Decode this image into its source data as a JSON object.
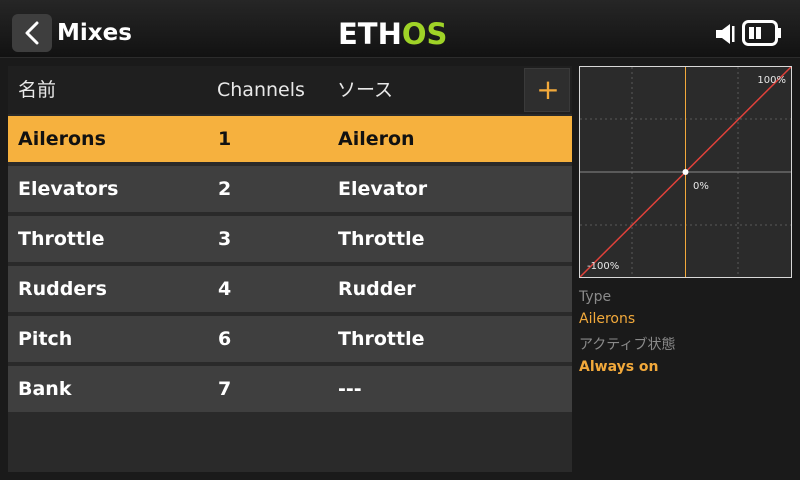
{
  "header": {
    "title": "Mixes",
    "logo_left": "ETH",
    "logo_right": "OS"
  },
  "colors": {
    "accent": "#f6b13e",
    "logo_green": "#9fd327",
    "curve": "#e0413a"
  },
  "icons": [
    "back-chevron-icon",
    "speaker-icon",
    "battery-icon",
    "plus-icon"
  ],
  "table": {
    "headers": {
      "name": "名前",
      "channels": "Channels",
      "source": "ソース"
    },
    "add_label": "+",
    "rows": [
      {
        "name": "Ailerons",
        "channel": "1",
        "source": "Aileron",
        "selected": true
      },
      {
        "name": "Elevators",
        "channel": "2",
        "source": "Elevator",
        "selected": false
      },
      {
        "name": "Throttle",
        "channel": "3",
        "source": "Throttle",
        "selected": false
      },
      {
        "name": "Rudders",
        "channel": "4",
        "source": "Rudder",
        "selected": false
      },
      {
        "name": "Pitch",
        "channel": "6",
        "source": "Throttle",
        "selected": false
      },
      {
        "name": "Bank",
        "channel": "7",
        "source": "---",
        "selected": false
      }
    ]
  },
  "graph": {
    "label_max": "100%",
    "label_center": "0%",
    "label_min": "-100%",
    "curve_points": [
      [
        -100,
        -100
      ],
      [
        100,
        100
      ]
    ],
    "cursor_x": 0
  },
  "info": {
    "type_label": "Type",
    "type_value": "Ailerons",
    "active_label": "アクティブ状態",
    "active_value": "Always on"
  }
}
